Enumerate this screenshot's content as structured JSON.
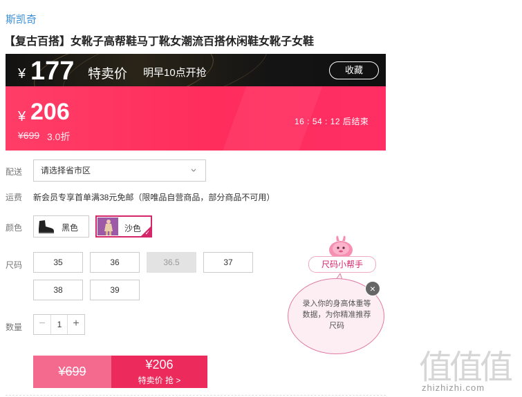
{
  "brand": "斯凯奇",
  "title": "【复古百搭】女靴子高帮鞋马丁靴女潮流百搭休闲鞋女靴子女鞋",
  "flash_sale": {
    "currency": "¥",
    "price": "177",
    "label": "特卖价",
    "time_text": "明早10点开抢",
    "favorite_label": "收藏"
  },
  "current_sale": {
    "currency": "¥",
    "price": "206",
    "original_price": "¥699",
    "discount": "3.0折",
    "countdown": "16 : 54 : 12 后结束"
  },
  "shipping": {
    "label": "配送",
    "placeholder": "请选择省市区"
  },
  "fee": {
    "label": "运费",
    "text": "新会员专享首单满38元免邮（限唯品自营商品，部分商品不可用）"
  },
  "colors": {
    "label": "颜色",
    "options": [
      {
        "name": "黑色",
        "selected": false
      },
      {
        "name": "沙色",
        "selected": true
      }
    ]
  },
  "sizes": {
    "label": "尺码",
    "options": [
      {
        "value": "35",
        "available": true
      },
      {
        "value": "36",
        "available": true
      },
      {
        "value": "36.5",
        "available": false
      },
      {
        "value": "37",
        "available": true
      },
      {
        "value": "38",
        "available": true
      },
      {
        "value": "39",
        "available": true
      }
    ]
  },
  "quantity": {
    "label": "数量",
    "minus": "−",
    "value": "1",
    "plus": "+"
  },
  "buy": {
    "original_price": "¥699",
    "sale_price": "¥206",
    "action": "特卖价 抢 >"
  },
  "size_helper": {
    "badge": "尺码小帮手",
    "bubble_text": "录入你的身高体重等数据，为你精准推荐尺码",
    "close": "×"
  },
  "watermark": {
    "logo": "值值值",
    "url": "zhizhizhi.com"
  },
  "colors_theme": {
    "accent": "#ec2a5b",
    "sale_banner": "#ff2d5c",
    "link": "#3a8fd6"
  }
}
